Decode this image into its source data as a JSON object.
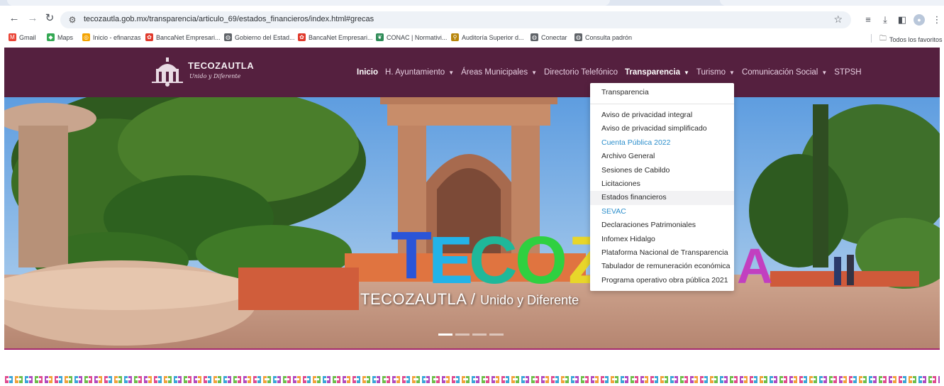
{
  "browser": {
    "url": "tecozautla.gob.mx/transparencia/articulo_69/estados_financieros/index.html#grecas",
    "bookmarks": [
      {
        "label": "Gmail",
        "color": "#ea4335",
        "glyph": "M"
      },
      {
        "label": "Maps",
        "color": "#34a853",
        "glyph": "◆"
      },
      {
        "label": "Inicio - efinanzas",
        "color": "#f4a300",
        "glyph": "◎"
      },
      {
        "label": "BancaNet Empresari...",
        "color": "#e0392b",
        "glyph": "✿"
      },
      {
        "label": "Gobierno del Estad...",
        "color": "#5f6368",
        "glyph": "◍"
      },
      {
        "label": "BancaNet Empresari...",
        "color": "#e0392b",
        "glyph": "✿"
      },
      {
        "label": "CONAC | Normativi...",
        "color": "#2e8b57",
        "glyph": "❦"
      },
      {
        "label": "Auditoría Superior d...",
        "color": "#b8860b",
        "glyph": "⚲"
      },
      {
        "label": "Conectar",
        "color": "#5f6368",
        "glyph": "◍"
      },
      {
        "label": "Consulta padrón",
        "color": "#5f6368",
        "glyph": "◍"
      }
    ],
    "all_bookmarks": "Todos los favoritos"
  },
  "site": {
    "logo_name": "TECOZAUTLA",
    "logo_slogan": "Unido y Diferente",
    "nav": [
      {
        "label": "Inicio",
        "active": true,
        "caret": false
      },
      {
        "label": "H. Ayuntamiento",
        "active": false,
        "caret": true
      },
      {
        "label": "Áreas Municipales",
        "active": false,
        "caret": true
      },
      {
        "label": "Directorio Telefónico",
        "active": false,
        "caret": false
      },
      {
        "label": "Transparencia",
        "active": true,
        "caret": true
      },
      {
        "label": "Turismo",
        "active": false,
        "caret": true
      },
      {
        "label": "Comunicación Social",
        "active": false,
        "caret": true
      },
      {
        "label": "STPSH",
        "active": false,
        "caret": false
      }
    ]
  },
  "dropdown": {
    "header": "Transparencia",
    "items": [
      {
        "label": "Aviso de privacidad integral",
        "style": "normal"
      },
      {
        "label": "Aviso de privacidad simplificado",
        "style": "normal"
      },
      {
        "label": "Cuenta Pública 2022",
        "style": "link"
      },
      {
        "label": "Archivo General",
        "style": "normal"
      },
      {
        "label": "Sesiones de Cabildo",
        "style": "normal"
      },
      {
        "label": "Licitaciones",
        "style": "normal"
      },
      {
        "label": "Estados financieros",
        "style": "hover"
      },
      {
        "label": "SEVAC",
        "style": "link"
      },
      {
        "label": "Declaraciones Patrimoniales",
        "style": "normal"
      },
      {
        "label": "Infomex Hidalgo",
        "style": "normal"
      },
      {
        "label": "Plataforma Nacional de Transparencia",
        "style": "normal"
      },
      {
        "label": "Tabulador de remuneración económica",
        "style": "normal"
      },
      {
        "label": "Programa operativo obra pública 2021",
        "style": "normal"
      }
    ]
  },
  "hero": {
    "caption_main": "TECOZAUTLA",
    "caption_sep": " / ",
    "caption_tail": "Unido y Diferente",
    "sign_letters": [
      "T",
      "E",
      "C",
      "O",
      "Z"
    ],
    "sign_right": "A"
  },
  "colors": {
    "header_bg": "#55203f",
    "accent_line": "#a4286e",
    "link": "#2b8ecb"
  }
}
